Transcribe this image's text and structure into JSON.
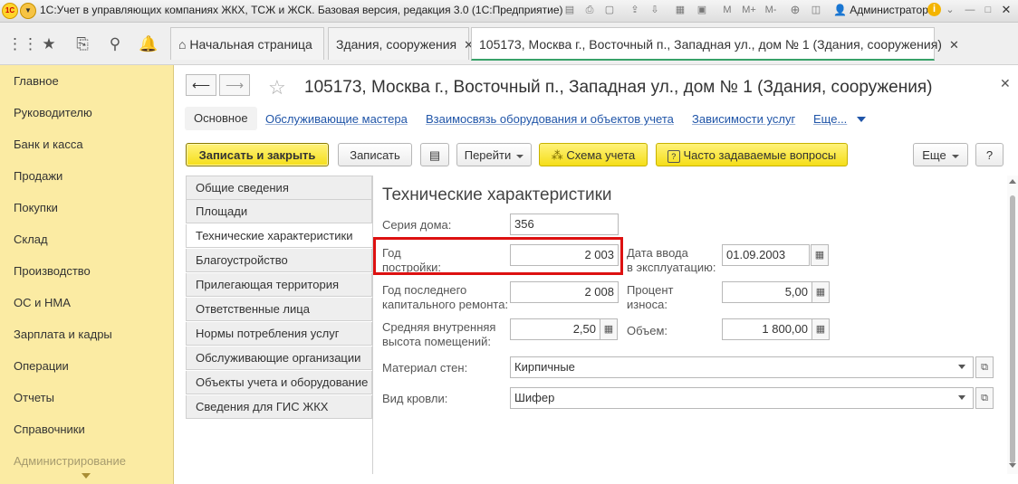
{
  "window": {
    "title": "1С:Учет в управляющих компаниях ЖКХ, ТСЖ и ЖСК. Базовая версия, редакция 3.0  (1С:Предприятие)",
    "logo_text": "1С",
    "user": "Администратор",
    "mem_labels": [
      "M",
      "M+",
      "M-"
    ]
  },
  "tabs": [
    {
      "label": "Начальная страница"
    },
    {
      "label": "Здания, сооружения"
    },
    {
      "label": "105173, Москва г., Восточный п., Западная ул., дом № 1 (Здания, сооружения)"
    }
  ],
  "sidebar": {
    "items": [
      "Главное",
      "Руководителю",
      "Банк и касса",
      "Продажи",
      "Покупки",
      "Склад",
      "Производство",
      "ОС и НМА",
      "Зарплата и кадры",
      "Операции",
      "Отчеты",
      "Справочники",
      "Администрирование"
    ]
  },
  "form": {
    "title": "105173, Москва г., Восточный п., Западная ул., дом № 1 (Здания, сооружения)",
    "links": {
      "main": "Основное",
      "masters": "Обслуживающие мастера",
      "relation": "Взаимосвязь оборудования и объектов учета",
      "deps": "Зависимости услуг",
      "more": "Еще..."
    },
    "buttons": {
      "save_close": "Записать и закрыть",
      "save": "Записать",
      "goto": "Перейти",
      "scheme": "Схема учета",
      "faq": "Часто задаваемые вопросы",
      "more": "Еще",
      "help": "?"
    },
    "groups": [
      "Общие сведения",
      "Площади",
      "Технические характеристики",
      "Благоустройство",
      "Прилегающая территория",
      "Ответственные лица",
      "Нормы потребления услуг",
      "Обслуживающие организации",
      "Объекты учета и оборудование",
      "Сведения для ГИС ЖКХ"
    ],
    "section_title": "Технические характеристики",
    "fields": {
      "series_label": "Серия дома:",
      "series_value": "356",
      "year_label_1": "Год",
      "year_label_2": "постройки:",
      "year_value": "2 003",
      "commission_label_1": "Дата ввода",
      "commission_label_2": "в эксплуатацию:",
      "commission_value": "01.09.2003",
      "repair_label_1": "Год последнего",
      "repair_label_2": "капитального ремонта:",
      "repair_value": "2 008",
      "wear_label_1": "Процент",
      "wear_label_2": "износа:",
      "wear_value": "5,00",
      "height_label_1": "Средняя внутренняя",
      "height_label_2": "высота помещений:",
      "height_value": "2,50",
      "volume_label": "Объем:",
      "volume_value": "1 800,00",
      "walls_label": "Материал стен:",
      "walls_value": "Кирпичные",
      "roof_label": "Вид кровли:",
      "roof_value": "Шифер"
    }
  },
  "colors": {
    "sidebar_bg": "#fbeba3",
    "accent_yellow": "#f5de19",
    "link": "#2055a8",
    "highlight": "#dd1111",
    "active_tab_line": "#38a169"
  }
}
